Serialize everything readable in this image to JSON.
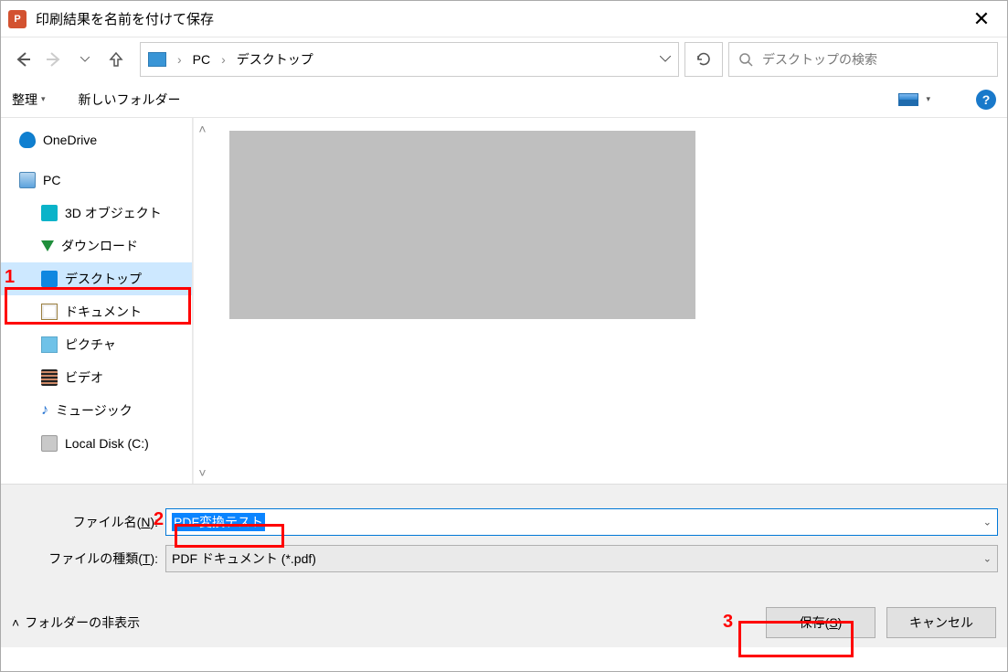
{
  "window": {
    "title": "印刷結果を名前を付けて保存"
  },
  "breadcrumb": {
    "seg1": "PC",
    "seg2": "デスクトップ"
  },
  "search": {
    "placeholder": "デスクトップの検索"
  },
  "toolbar": {
    "organize": "整理",
    "newfolder": "新しいフォルダー"
  },
  "tree": {
    "onedrive": "OneDrive",
    "pc": "PC",
    "objects3d": "3D オブジェクト",
    "downloads": "ダウンロード",
    "desktop": "デスクトップ",
    "documents": "ドキュメント",
    "pictures": "ピクチャ",
    "videos": "ビデオ",
    "music": "ミュージック",
    "localdisk": "Local Disk (C:)"
  },
  "fields": {
    "filename_label": "ファイル名(N):",
    "filename_value": "PDF変換テスト",
    "filetype_label": "ファイルの種類(T):",
    "filetype_value": "PDF ドキュメント (*.pdf)"
  },
  "actions": {
    "hide_folders": "フォルダーの非表示",
    "save": "保存(S)",
    "cancel": "キャンセル"
  },
  "annotations": {
    "a1": "1",
    "a2": "2",
    "a3": "3"
  }
}
